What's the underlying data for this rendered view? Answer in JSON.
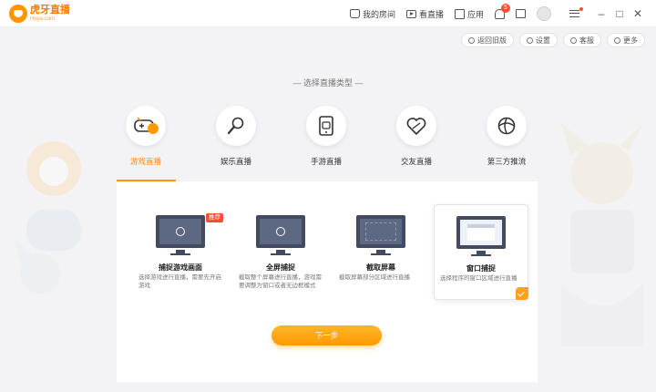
{
  "app": {
    "name": "虎牙直播",
    "domain": "Huya.com"
  },
  "top_nav": {
    "my_room": "我的房间",
    "watch_live": "看直播",
    "apps": "应用",
    "notification_count": "5"
  },
  "toolbar": {
    "back_old": "返回旧版",
    "settings": "设置",
    "service": "客服",
    "more": "更多"
  },
  "section_title": "— 选择直播类型 —",
  "categories": [
    {
      "label": "游戏直播",
      "icon": "gamepad-icon",
      "active": true
    },
    {
      "label": "娱乐直播",
      "icon": "microphone-icon",
      "active": false
    },
    {
      "label": "手游直播",
      "icon": "phone-icon",
      "active": false
    },
    {
      "label": "交友直播",
      "icon": "heart-icon",
      "active": false
    },
    {
      "label": "第三方推流",
      "icon": "stream-icon",
      "active": false
    }
  ],
  "modes": [
    {
      "title": "捕捉游戏画面",
      "desc": "选择游戏进行直播，需要先开启游戏",
      "badge": "推荐"
    },
    {
      "title": "全屏捕捉",
      "desc": "截取整个屏幕进行直播，游戏需要调整为窗口或者无边框模式"
    },
    {
      "title": "截取屏幕",
      "desc": "截取屏幕部分区域进行直播"
    },
    {
      "title": "窗口捕捉",
      "desc": "选择程序的窗口区域进行直播",
      "selected": true
    }
  ],
  "next_label": "下一步",
  "colors": {
    "accent": "#ff9900",
    "badge": "#ff4d2d"
  }
}
